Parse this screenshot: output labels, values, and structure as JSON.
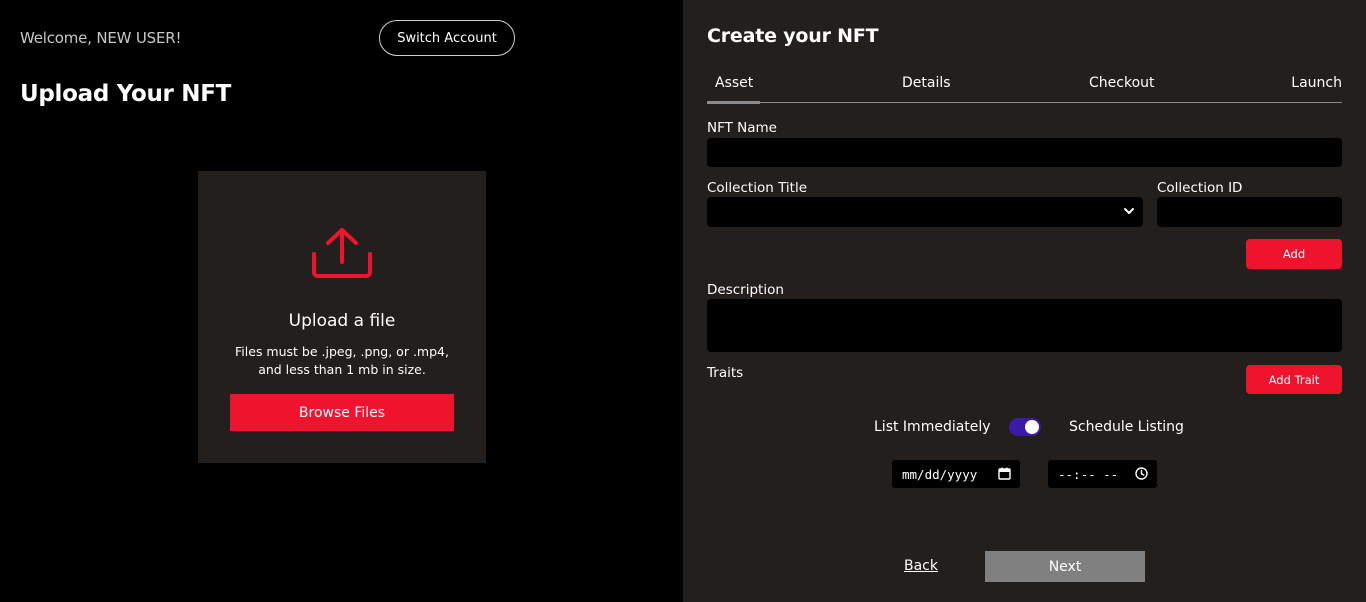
{
  "left": {
    "welcome_text": "Welcome, NEW USER!",
    "switch_account_label": "Switch Account",
    "upload_title": "Upload Your NFT",
    "upload_box": {
      "icon": "upload-icon",
      "heading": "Upload a file",
      "hint_line1": "Files must be .jpeg, .png, or .mp4,",
      "hint_line2": "and less than 1 mb in size.",
      "browse_label": "Browse Files"
    }
  },
  "right": {
    "title": "Create your NFT",
    "tabs": [
      {
        "label": "Asset",
        "active": true
      },
      {
        "label": "Details",
        "active": false
      },
      {
        "label": "Checkout",
        "active": false
      },
      {
        "label": "Launch",
        "active": false
      }
    ],
    "form": {
      "nft_name_label": "NFT Name",
      "nft_name_value": "",
      "collection_title_label": "Collection Title",
      "collection_title_value": "",
      "collection_id_label": "Collection ID",
      "collection_id_value": "",
      "add_label": "Add",
      "description_label": "Description",
      "description_value": "",
      "traits_label": "Traits",
      "add_trait_label": "Add Trait",
      "list_immediately_label": "List Immediately",
      "schedule_listing_label": "Schedule Listing",
      "toggle_on": true,
      "date_placeholder": "mm/dd/yyyy",
      "time_placeholder": "--:-- --"
    },
    "footer": {
      "back_label": "Back",
      "next_label": "Next"
    }
  },
  "colors": {
    "accent_red": "#f0132e",
    "toggle_purple": "#3b1aa8",
    "panel_bg": "#221f1c",
    "next_disabled": "#808080"
  }
}
